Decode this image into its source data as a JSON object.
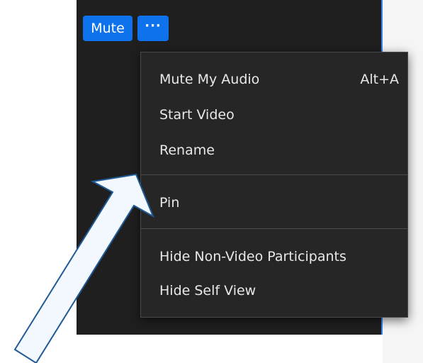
{
  "toolbar": {
    "mute_label": "Mute",
    "more_label": "···"
  },
  "menu": {
    "items": [
      {
        "label": "Mute My Audio",
        "shortcut": "Alt+A"
      },
      {
        "label": "Start Video"
      },
      {
        "label": "Rename"
      },
      {
        "label": "Pin"
      },
      {
        "label": "Hide Non-Video Participants"
      },
      {
        "label": "Hide Self View"
      }
    ]
  },
  "colors": {
    "accent": "#0e72ed",
    "menu_bg": "#262626",
    "panel_bg": "#1f1f1f",
    "annotation_arrow_fill": "#f2f8fd",
    "annotation_arrow_stroke": "#1f5a96"
  },
  "icons": {
    "annotation": "arrow-pointer-icon"
  }
}
